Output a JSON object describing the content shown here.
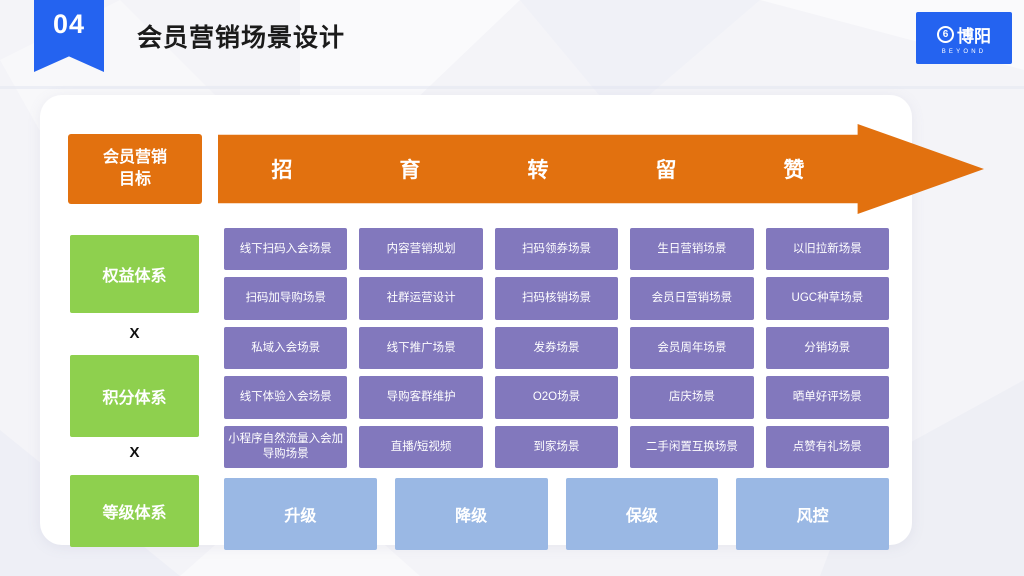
{
  "header": {
    "section_number": "04",
    "title": "会员营销场景设计",
    "logo": {
      "mark": "6",
      "name_cn": "博阳",
      "name_en": "BEYOND"
    }
  },
  "colors": {
    "accent_blue": "#2463f0",
    "orange": "#e2710f",
    "green": "#8ed04e",
    "purple": "#8278bd",
    "light_blue": "#9ab8e4",
    "page_bg": "#f4f4f8",
    "card_bg": "#ffffff"
  },
  "goal": {
    "label_line1": "会员营销",
    "label_line2": "目标"
  },
  "stages": [
    "招",
    "育",
    "转",
    "留",
    "赞"
  ],
  "systems": [
    {
      "label": "权益体系"
    },
    {
      "label": "积分体系"
    },
    {
      "label": "等级体系"
    }
  ],
  "operators": [
    "X",
    "X"
  ],
  "scenarios": {
    "columns": [
      {
        "stage": "招",
        "cells": [
          "线下扫码入会场景",
          "扫码加导购场景",
          "私域入会场景",
          "线下体验入会场景",
          "小程序自然流量入会加导购场景"
        ]
      },
      {
        "stage": "育",
        "cells": [
          "内容营销规划",
          "社群运营设计",
          "线下推广场景",
          "导购客群维护",
          "直播/短视频"
        ]
      },
      {
        "stage": "转",
        "cells": [
          "扫码领券场景",
          "扫码核销场景",
          "发券场景",
          "O2O场景",
          "到家场景"
        ]
      },
      {
        "stage": "留",
        "cells": [
          "生日营销场景",
          "会员日营销场景",
          "会员周年场景",
          "店庆场景",
          "二手闲置互换场景"
        ]
      },
      {
        "stage": "赞",
        "cells": [
          "以旧拉新场景",
          "UGC种草场景",
          "分销场景",
          "晒单好评场景",
          "点赞有礼场景"
        ]
      }
    ],
    "rows": [
      [
        "线下扫码入会场景",
        "内容营销规划",
        "扫码领券场景",
        "生日营销场景",
        "以旧拉新场景"
      ],
      [
        "扫码加导购场景",
        "社群运营设计",
        "扫码核销场景",
        "会员日营销场景",
        "UGC种草场景"
      ],
      [
        "私域入会场景",
        "线下推广场景",
        "发券场景",
        "会员周年场景",
        "分销场景"
      ],
      [
        "线下体验入会场景",
        "导购客群维护",
        "O2O场景",
        "店庆场景",
        "晒单好评场景"
      ],
      [
        "小程序自然流量入会加导购场景",
        "直播/短视频",
        "到家场景",
        "二手闲置互换场景",
        "点赞有礼场景"
      ]
    ]
  },
  "tier_actions": [
    "升级",
    "降级",
    "保级",
    "风控"
  ]
}
